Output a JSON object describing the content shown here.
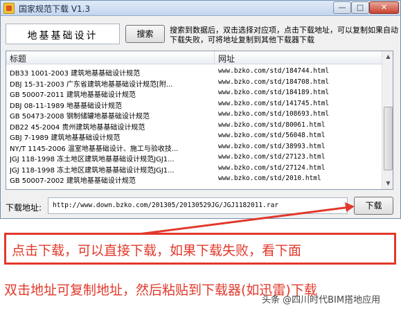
{
  "window": {
    "title": "国家规范下载 V1.3",
    "minimize_glyph": "—",
    "maximize_glyph": "□",
    "close_glyph": "✕"
  },
  "search": {
    "value": "地基基础设计",
    "button_label": "搜索",
    "hint": "搜索到数据后，双击选择对应项，点击下载地址，可以复制如果自动下载失败，可将地址复制到其他下载器下载"
  },
  "table": {
    "columns": [
      "标题",
      "网址"
    ],
    "rows": [
      {
        "title": "DB33 1001-2003 建筑地基基础设计规范",
        "url": "www.bzko.com/std/184744.html"
      },
      {
        "title": "DBJ 15-31-2003 广东省建筑地基基础设计规范[附...",
        "url": "www.bzko.com/std/184708.html"
      },
      {
        "title": "GB 50007-2011 建筑地基基础设计规范",
        "url": "www.bzko.com/std/184189.html"
      },
      {
        "title": "DBJ 08-11-1989 地基基础设计规范",
        "url": "www.bzko.com/std/141745.html"
      },
      {
        "title": "GB 50473-2008 钢制储罐地基基础设计规范",
        "url": "www.bzko.com/std/108693.html"
      },
      {
        "title": "DB22 45-2004 贵州建筑地基基础设计规范",
        "url": "www.bzko.com/std/80061.html"
      },
      {
        "title": "GBJ 7-1989 建筑地基基础设计规范",
        "url": "www.bzko.com/std/56048.html"
      },
      {
        "title": "NY/T 1145-2006 温室地基基础设计、施工与验收技...",
        "url": "www.bzko.com/std/38993.html"
      },
      {
        "title": "JGJ 118-1998 冻土地区建筑地基基础设计规范JGJ1...",
        "url": "www.bzko.com/std/27123.html"
      },
      {
        "title": "JGJ 118-1998 冻土地区建筑地基基础设计规范JGJ1...",
        "url": "www.bzko.com/std/27124.html"
      },
      {
        "title": "GB 50007-2002 建筑地基基础设计规范",
        "url": "www.bzko.com/std/2010.html"
      }
    ]
  },
  "download": {
    "label": "下载地址:",
    "url": "http://www.down.bzko.com/201305/20130529JG/JGJ1182011.rar",
    "button_label": "下载"
  },
  "annotation": {
    "callout": "点击下载，可以直接下载，如果下载失败，看下面",
    "note": "双击地址可复制地址，然后粘贴到下载器(如迅雷)下载",
    "watermark": "头条 @四川时代BIM搭地应用",
    "color": "#e2382b"
  },
  "scrollbar": {
    "up_glyph": "▲",
    "down_glyph": "▼"
  }
}
